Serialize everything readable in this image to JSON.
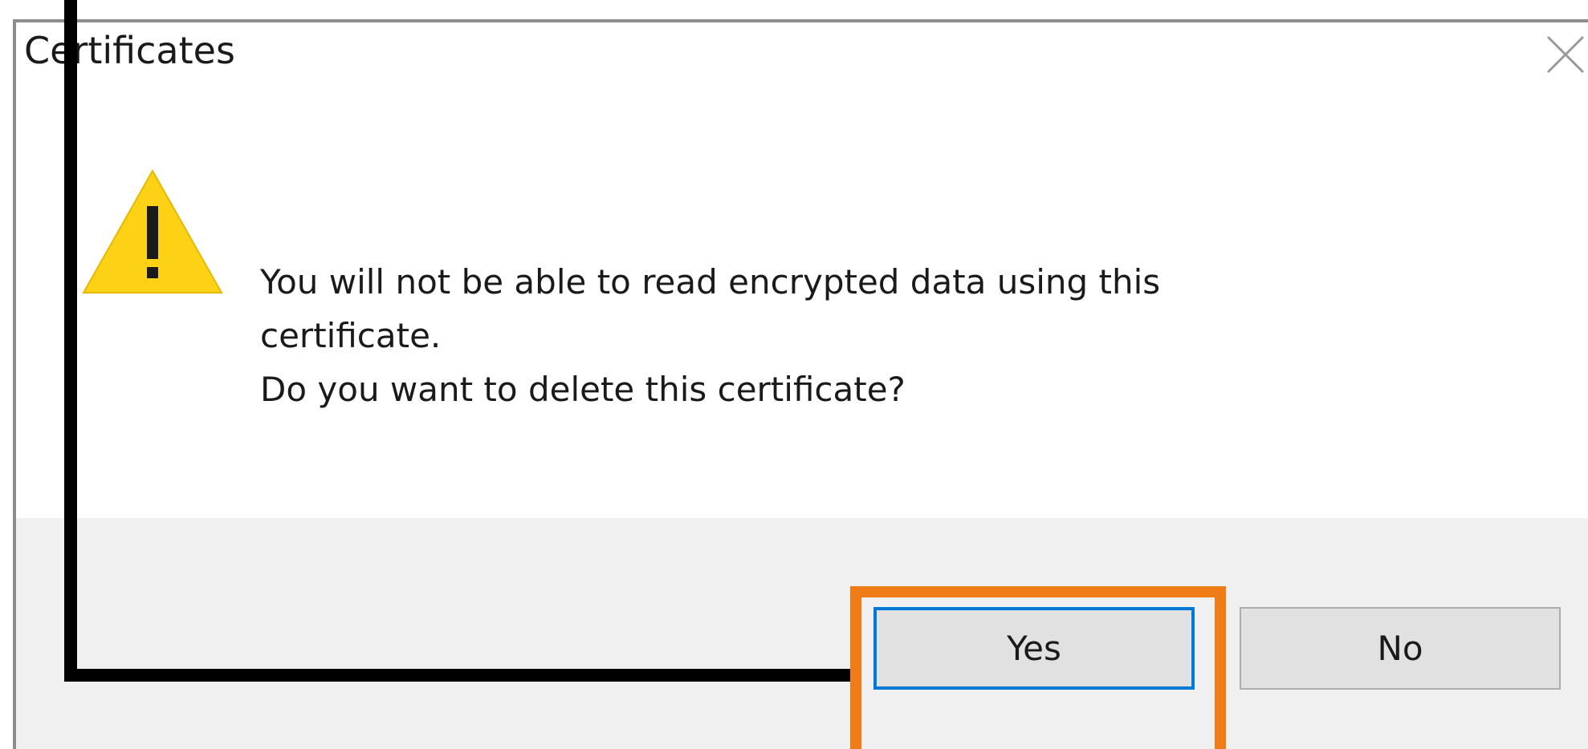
{
  "dialog": {
    "title": "Certificates",
    "icons": {
      "close": "close-icon",
      "warning": "warning-icon"
    },
    "message": {
      "line1": "You will not be able to read encrypted data using this",
      "line2": "certificate.",
      "line3": "Do you want to delete this certificate?"
    },
    "buttons": {
      "yes": "Yes",
      "no": "No"
    }
  },
  "colors": {
    "highlight_box": "#f07c18",
    "pointer_line": "#000000",
    "warning_fill": "#fcd116",
    "focus_border": "#0078d7",
    "footer_bg": "#f0f0f0"
  }
}
